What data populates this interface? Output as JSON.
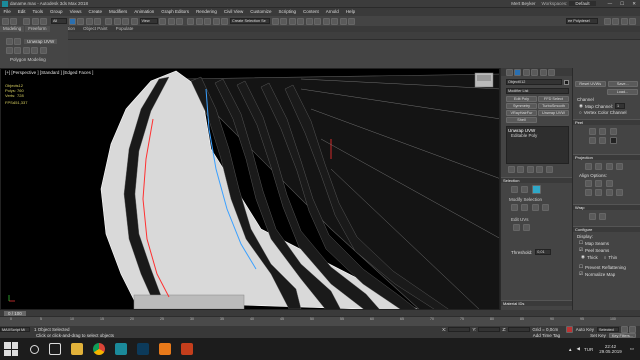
{
  "window": {
    "title": "daname.max - Autodesk 3ds Max 2018",
    "user": "Mert Beyker",
    "workspace_label": "Workspaces:",
    "workspace": "Default"
  },
  "menu": [
    "File",
    "Edit",
    "Tools",
    "Group",
    "Views",
    "Create",
    "Modifiers",
    "Animation",
    "Graph Editors",
    "Rendering",
    "Civil View",
    "Customize",
    "Scripting",
    "Content",
    "Arnold",
    "Help"
  ],
  "toolbar": {
    "filter_value": "All",
    "view_value": "View",
    "selection_set": "Create Selection Se",
    "poly_label": "ee Polydesel"
  },
  "ribbon": {
    "tabs": [
      "Modeling",
      "Freeform",
      "Selection",
      "Object Paint",
      "Populate"
    ],
    "sub_tab": "Polygon Modeling",
    "unwrap": "Unwrap UVW"
  },
  "viewport": {
    "label": "[+] [Perspective ] [Standard ] [Edged Faces ]",
    "stats": {
      "header": "Objects12",
      "polys_label": "Polys:",
      "polys": "760",
      "verts_label": "Verts:",
      "verts": "728",
      "fps_label": "FPS:",
      "fps": "451,337"
    }
  },
  "command_panel": {
    "object_name": "Object012",
    "modifier_list": "Modifier List",
    "buttons": [
      "Edit Poly",
      "FFD Select",
      "Symmetry",
      "TurboSmooth",
      "VRayHairFur",
      "VPorts",
      "Unwrap UVW",
      "Shell"
    ],
    "stack": [
      "Unwrap UVW",
      "Editable Poly"
    ],
    "selection_head": "Selection",
    "modify_selection": "Modify Selection",
    "edit_uvs": "Edit UVs",
    "threshold_label": "Threshold:",
    "threshold": "0,01",
    "material_ids": "Material IDs"
  },
  "right_panel": {
    "reset_btn": "Reset UVWs",
    "save_btn": "Save...",
    "load_btn": "Load...",
    "channel_head": "Channel",
    "map_channel_label": "Map Channel:",
    "map_channel": "1",
    "vertex_color": "Vertex Color Channel",
    "peel_head": "Peel",
    "projection_head": "Projection",
    "align_head": "Align Options:",
    "wrap_head": "Wrap",
    "configure_head": "Configure",
    "display_head": "Display:",
    "map_seams": "Map Seams",
    "peel_seams": "Peel Seams",
    "thick": "Thick",
    "thin": "Thin",
    "prevent_reflatten": "Prevent Reflattening",
    "normalize_map": "Normalize Map"
  },
  "timeline": {
    "frame": "0 / 100",
    "ticks": [
      "0",
      "5",
      "10",
      "15",
      "20",
      "25",
      "30",
      "35",
      "40",
      "45",
      "50",
      "55",
      "60",
      "65",
      "70",
      "75",
      "80",
      "85",
      "90",
      "95",
      "100"
    ]
  },
  "status": {
    "maxscript": "MAXScript Mi",
    "selection": "1 Object Selected",
    "prompt": "Click or click-and-drag to select objects",
    "x_label": "X:",
    "y_label": "Y:",
    "z_label": "Z:",
    "grid": "Grid = 0,0cm",
    "add_time_tag": "Add Time Tag",
    "auto_key": "Auto Key",
    "selected": "Selected",
    "set_key": "Set Key",
    "key_filters": "Key Filters..."
  },
  "taskbar": {
    "time": "22:42",
    "date": "29.05.2019",
    "lang": "TUR"
  },
  "colors": {
    "viewport_bg": "#000000",
    "accent": "#3a8fd6",
    "active_tab": "#2a6fb0"
  }
}
